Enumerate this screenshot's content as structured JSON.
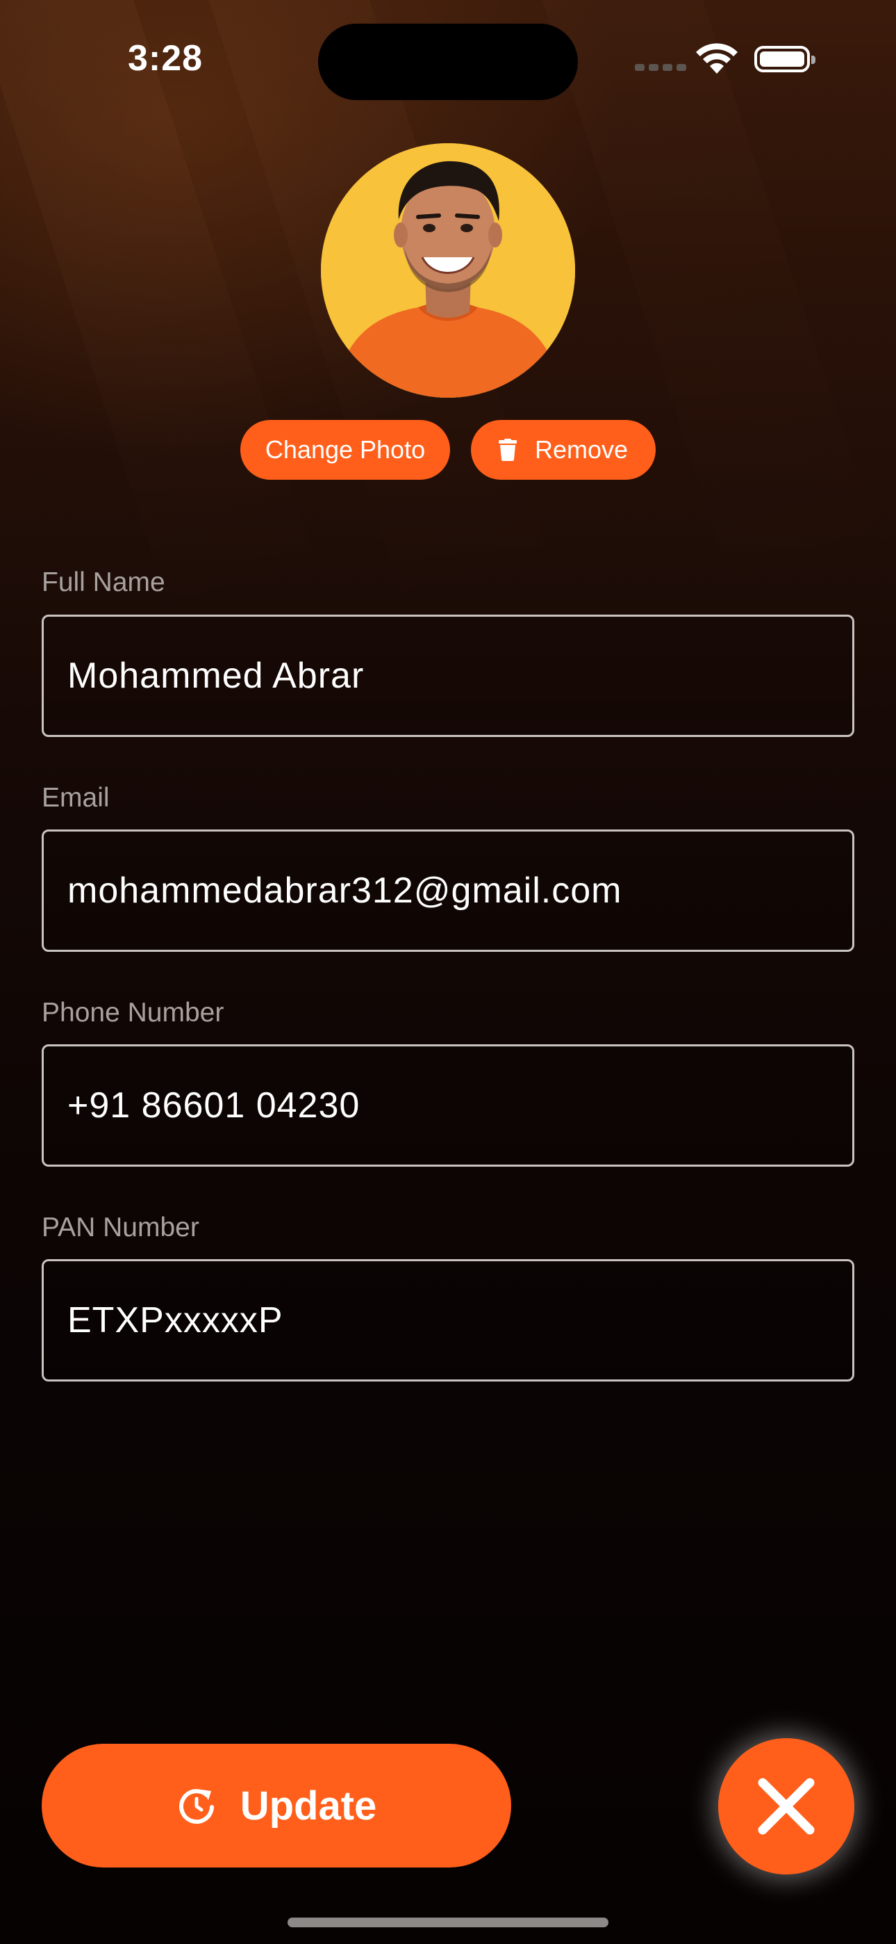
{
  "status_bar": {
    "time": "3:28"
  },
  "profile": {
    "change_photo_label": "Change Photo",
    "remove_label": "Remove"
  },
  "form": {
    "full_name": {
      "label": "Full Name",
      "value": "Mohammed Abrar"
    },
    "email": {
      "label": "Email",
      "value": "mohammedabrar312@gmail.com"
    },
    "phone": {
      "label": "Phone Number",
      "value": "+91 86601 04230"
    },
    "pan": {
      "label": "PAN Number",
      "value": "ETXPxxxxxP"
    }
  },
  "actions": {
    "update_label": "Update"
  },
  "icons": {
    "remove": "trash-icon",
    "update": "refresh-icon",
    "close": "close-icon"
  },
  "colors": {
    "accent": "#ff5f1a",
    "background_top": "#3a1a0b",
    "background_bottom": "#060202",
    "field_border": "#c9c4c0",
    "label": "#a8a29e",
    "avatar_background": "#f8c23a"
  }
}
